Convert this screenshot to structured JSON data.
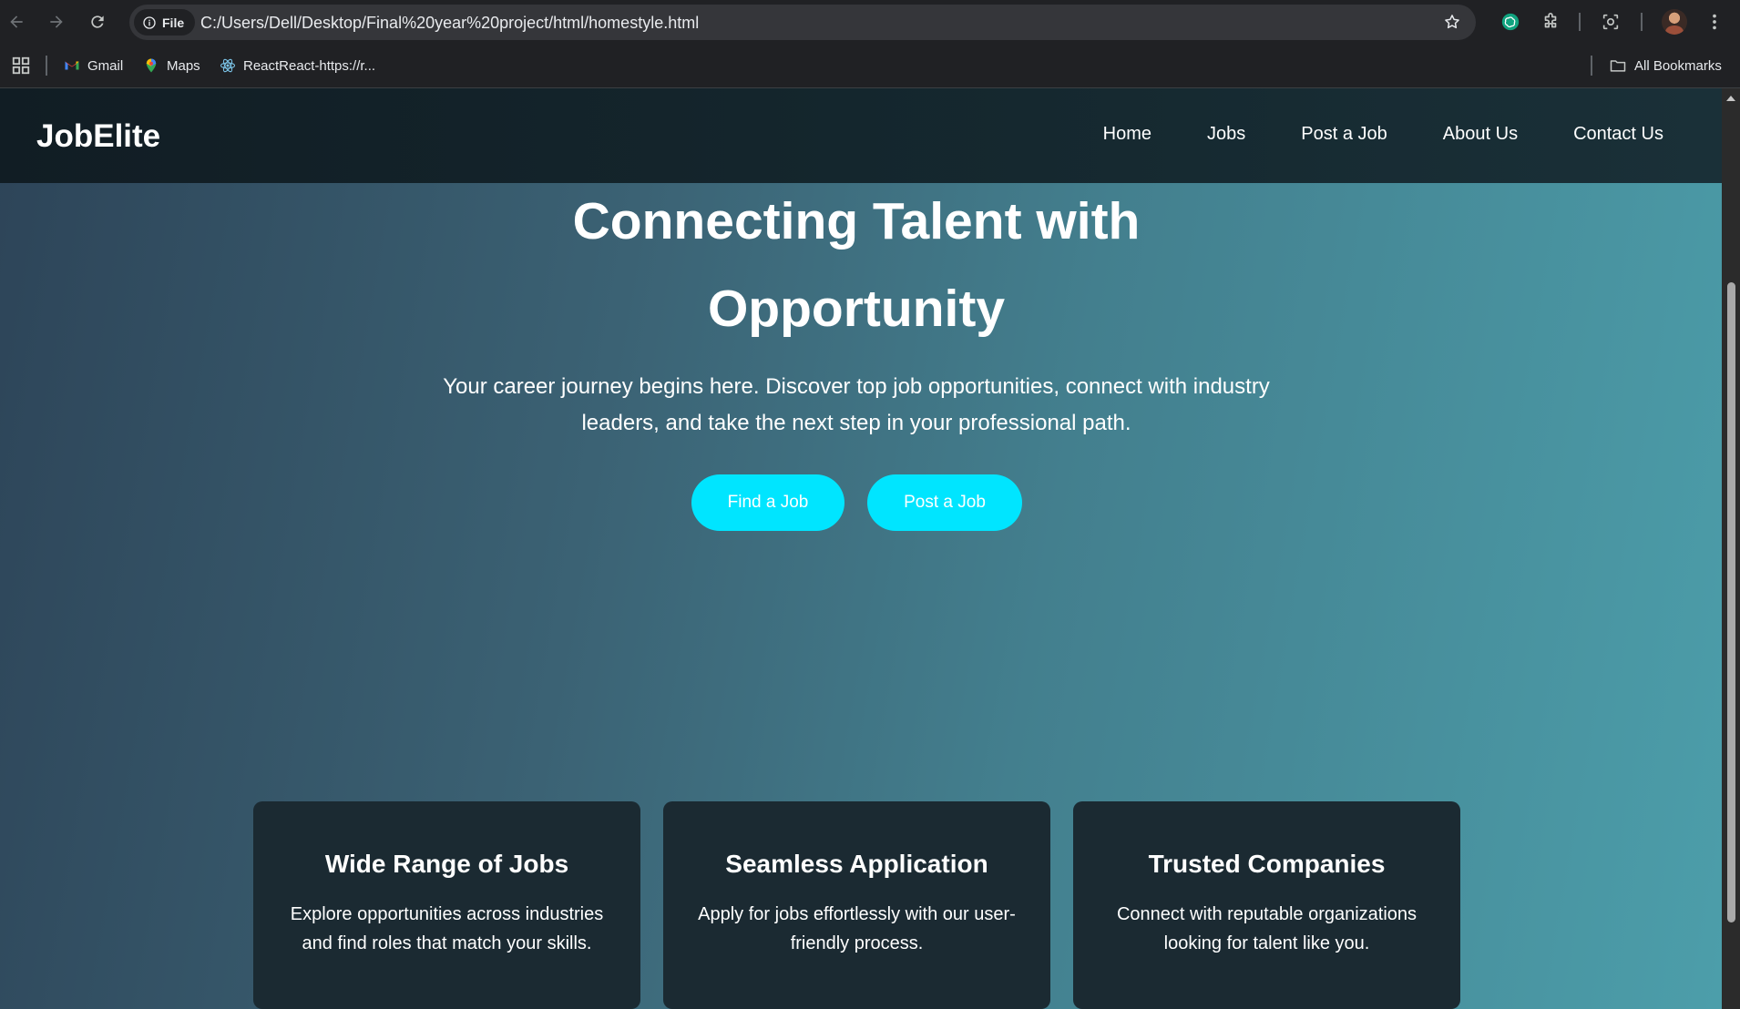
{
  "browser": {
    "file_chip_label": "File",
    "url": "C:/Users/Dell/Desktop/Final%20year%20project/html/homestyle.html",
    "bookmarks": [
      {
        "label": "Gmail",
        "icon": "gmail-icon"
      },
      {
        "label": "Maps",
        "icon": "maps-pin-icon"
      },
      {
        "label": "ReactReact-https://r...",
        "icon": "react-icon"
      }
    ],
    "all_bookmarks_label": "All Bookmarks"
  },
  "site": {
    "logo": "JobElite",
    "nav": [
      "Home",
      "Jobs",
      "Post a Job",
      "About Us",
      "Contact Us"
    ]
  },
  "hero": {
    "title_line1": "Connecting Talent with",
    "title_line2": "Opportunity",
    "subtitle": "Your career journey begins here. Discover top job opportunities, connect with industry leaders, and take the next step in your professional path.",
    "primary_button": "Find a Job",
    "secondary_button": "Post a Job"
  },
  "features": [
    {
      "title": "Wide Range of Jobs",
      "text": "Explore opportunities across industries and find roles that match your skills."
    },
    {
      "title": "Seamless Application",
      "text": "Apply for jobs effortlessly with our user-friendly process."
    },
    {
      "title": "Trusted Companies",
      "text": "Connect with reputable organizations looking for talent like you."
    }
  ],
  "colors": {
    "accent_button": "#00e5ff",
    "header_bg": "#111d24",
    "card_bg": "#1b2a32",
    "hero_gradient_start": "#2d4458",
    "hero_gradient_end": "#4c9eaa"
  }
}
